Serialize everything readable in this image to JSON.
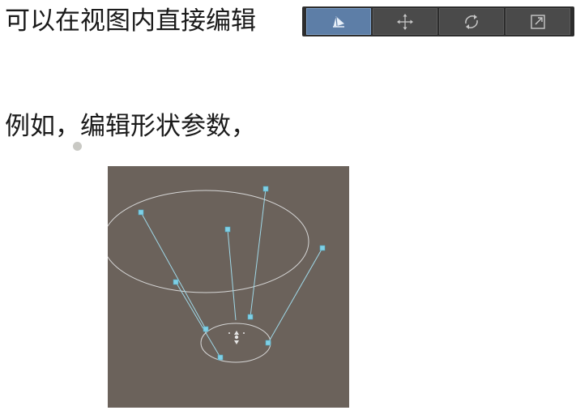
{
  "line1": {
    "text": "可以在视图内直接编辑"
  },
  "toolbar": {
    "buttons": [
      {
        "icon": "edit-shape-icon",
        "active": true
      },
      {
        "icon": "move-icon",
        "active": false
      },
      {
        "icon": "rotate-icon",
        "active": false
      },
      {
        "icon": "scale-icon",
        "active": false
      }
    ]
  },
  "line2": {
    "text": "例如，编辑形状参数，"
  },
  "viewport": {
    "background": "#6b625b",
    "gizmo_color": "#7fd0e6",
    "outline_color": "#d6d6d6"
  }
}
